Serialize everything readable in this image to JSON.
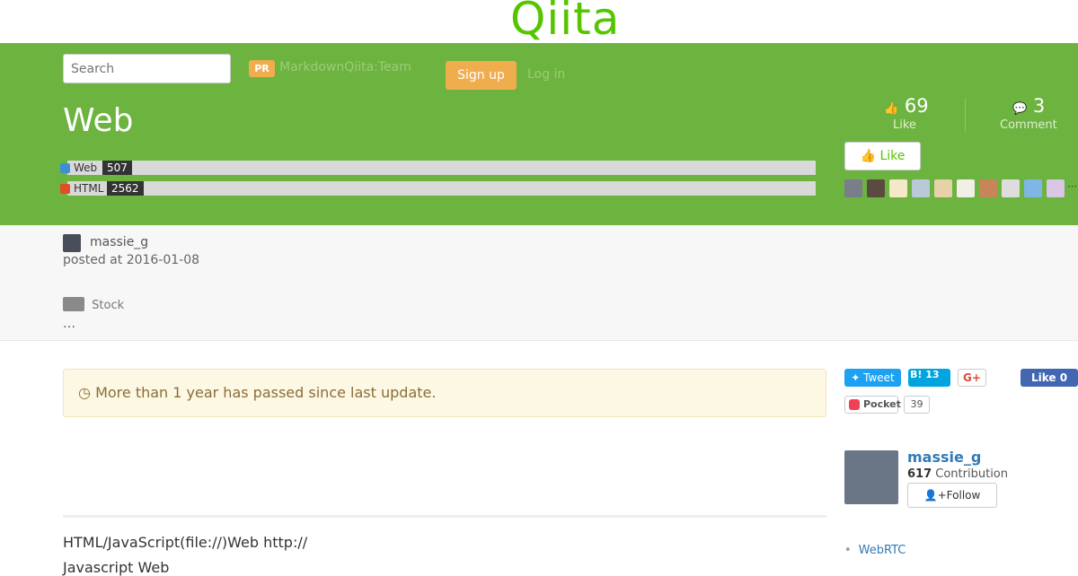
{
  "header": {
    "logo_text": "Qiita"
  },
  "nav": {
    "search_placeholder": "Search",
    "pr_badge": "PR",
    "pr_text": "MarkdownQiita:Team",
    "signup_label": "Sign up",
    "login_label": "Log in"
  },
  "article": {
    "title": "Web",
    "tags": [
      {
        "name": "Web",
        "count": "507",
        "icon": "globe-icon"
      },
      {
        "name": "HTML",
        "count": "2562",
        "icon": "html5-icon"
      }
    ],
    "likes_count": "69",
    "likes_label": "Like",
    "comments_count": "3",
    "comments_label": "Comment",
    "like_button_label": "Like",
    "author": "massie_g",
    "posted": "posted at 2016-01-08",
    "stock_label": "Stock",
    "more_label": "…",
    "alert_text": "More than 1 year has passed since last update.",
    "body_line1": "HTML/JavaScript(file://)Web http://",
    "body_line2": "Javascript  Web"
  },
  "share": {
    "tweet": "Tweet",
    "hatena": "B! 13",
    "gplus": "G+",
    "facebook": "Like 0",
    "pocket": "Pocket",
    "pocket_count": "39"
  },
  "user_card": {
    "name": "massie_g",
    "contribution_count": "617",
    "contribution_label": "Contribution",
    "follow_label": "Follow"
  },
  "sidebar": {
    "links": [
      "WebRTC"
    ]
  },
  "colors": {
    "brand_green": "#55c500",
    "hero_green": "#6cb33f",
    "signup_orange": "#f0ad4e",
    "alert_bg": "#fcf8e3"
  }
}
